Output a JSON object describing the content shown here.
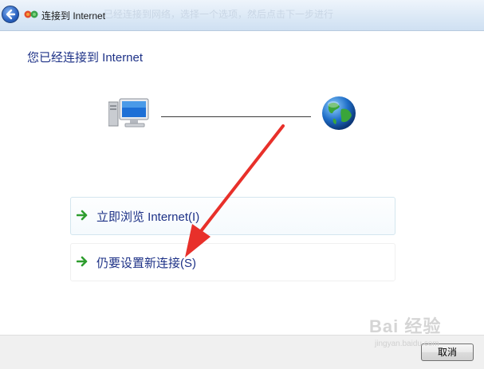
{
  "window": {
    "title": "连接到 Internet",
    "faint_banner": "…已经连接到网络，选择一个选项，然后点击下一步进行"
  },
  "main": {
    "heading": "您已经连接到 Internet"
  },
  "options": [
    {
      "label": "立即浏览 Internet(I)",
      "icon": "green-arrow-icon"
    },
    {
      "label": "仍要设置新连接(S)",
      "icon": "green-arrow-icon"
    }
  ],
  "footer": {
    "cancel_label": "取消"
  },
  "watermark": {
    "brand": "Bai 经验",
    "url": "jingyan.baidu.com"
  },
  "colors": {
    "link_blue": "#1e3287",
    "annotation_red": "#e8302a",
    "arrow_green": "#2e9d2e"
  }
}
